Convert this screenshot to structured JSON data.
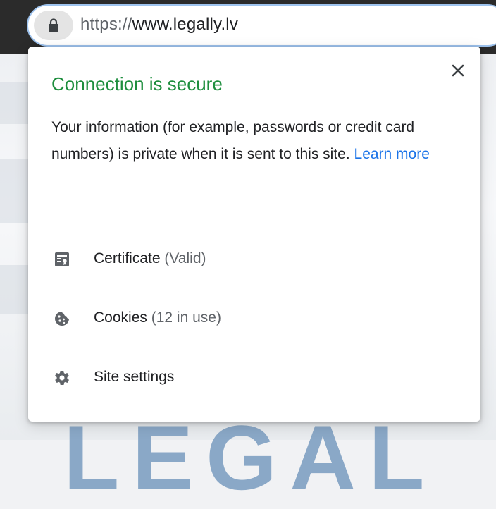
{
  "omnibox": {
    "url_scheme": "https://",
    "url_host": "www.legally.lv"
  },
  "background": {
    "big_text": "LEGAL"
  },
  "popup": {
    "title": "Connection is secure",
    "title_color": "#1e8e3e",
    "description": "Your information (for example, passwords or credit card numbers) is private when it is sent to this site.",
    "learn_more": "Learn more",
    "link_color": "#1a73e8",
    "items": [
      {
        "icon": "certificate-icon",
        "label": "Certificate",
        "detail": "(Valid)"
      },
      {
        "icon": "cookie-icon",
        "label": "Cookies",
        "detail": "(12 in use)"
      },
      {
        "icon": "gear-icon",
        "label": "Site settings",
        "detail": ""
      }
    ]
  }
}
